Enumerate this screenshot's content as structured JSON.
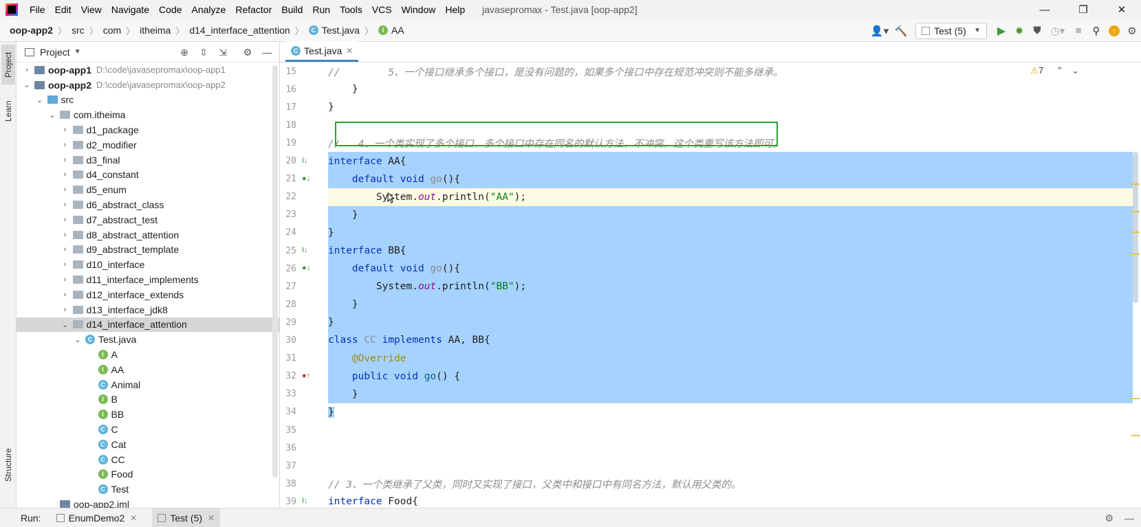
{
  "menubar": {
    "items": [
      "File",
      "Edit",
      "View",
      "Navigate",
      "Code",
      "Analyze",
      "Refactor",
      "Build",
      "Run",
      "Tools",
      "VCS",
      "Window",
      "Help"
    ],
    "title": "javasepromax - Test.java [oop-app2]"
  },
  "breadcrumbs": [
    "oop-app2",
    "src",
    "com",
    "itheima",
    "d14_interface_attention",
    "Test.java",
    "AA"
  ],
  "run_config": "Test (5)",
  "stripe": {
    "project": "Project",
    "learn": "Learn",
    "structure": "Structure"
  },
  "project": {
    "header": "Project",
    "tree": [
      {
        "label": "oop-app1",
        "path": "D:\\code\\javasepromax\\oop-app1",
        "level": 0,
        "kind": "module",
        "expanded": false
      },
      {
        "label": "oop-app2",
        "path": "D:\\code\\javasepromax\\oop-app2",
        "level": 0,
        "kind": "module",
        "expanded": true
      },
      {
        "label": "src",
        "level": 1,
        "kind": "src",
        "expanded": true
      },
      {
        "label": "com.itheima",
        "level": 2,
        "kind": "package",
        "expanded": true
      },
      {
        "label": "d1_package",
        "level": 3,
        "kind": "package",
        "expanded": false
      },
      {
        "label": "d2_modifier",
        "level": 3,
        "kind": "package",
        "expanded": false
      },
      {
        "label": "d3_final",
        "level": 3,
        "kind": "package",
        "expanded": false
      },
      {
        "label": "d4_constant",
        "level": 3,
        "kind": "package",
        "expanded": false
      },
      {
        "label": "d5_enum",
        "level": 3,
        "kind": "package",
        "expanded": false
      },
      {
        "label": "d6_abstract_class",
        "level": 3,
        "kind": "package",
        "expanded": false
      },
      {
        "label": "d7_abstract_test",
        "level": 3,
        "kind": "package",
        "expanded": false
      },
      {
        "label": "d8_abstract_attention",
        "level": 3,
        "kind": "package",
        "expanded": false
      },
      {
        "label": "d9_abstract_template",
        "level": 3,
        "kind": "package",
        "expanded": false
      },
      {
        "label": "d10_interface",
        "level": 3,
        "kind": "package",
        "expanded": false
      },
      {
        "label": "d11_interface_implements",
        "level": 3,
        "kind": "package",
        "expanded": false
      },
      {
        "label": "d12_interface_extends",
        "level": 3,
        "kind": "package",
        "expanded": false
      },
      {
        "label": "d13_interface_jdk8",
        "level": 3,
        "kind": "package",
        "expanded": false
      },
      {
        "label": "d14_interface_attention",
        "level": 3,
        "kind": "package",
        "expanded": true,
        "selected": true
      },
      {
        "label": "Test.java",
        "level": 4,
        "kind": "file",
        "expanded": true
      },
      {
        "label": "A",
        "level": 5,
        "kind": "interface"
      },
      {
        "label": "AA",
        "level": 5,
        "kind": "interface"
      },
      {
        "label": "Animal",
        "level": 5,
        "kind": "class"
      },
      {
        "label": "B",
        "level": 5,
        "kind": "interface"
      },
      {
        "label": "BB",
        "level": 5,
        "kind": "interface"
      },
      {
        "label": "C",
        "level": 5,
        "kind": "class"
      },
      {
        "label": "Cat",
        "level": 5,
        "kind": "class"
      },
      {
        "label": "CC",
        "level": 5,
        "kind": "class"
      },
      {
        "label": "Food",
        "level": 5,
        "kind": "interface"
      },
      {
        "label": "Test",
        "level": 5,
        "kind": "mainclass"
      },
      {
        "label": "oop-app2.iml",
        "level": 2,
        "kind": "iml"
      }
    ]
  },
  "editor": {
    "tab": "Test.java",
    "warnings": "7",
    "lines": [
      {
        "n": "15",
        "tokens": [
          [
            "cm",
            "//        5、一个接口继承多个接口，是没有问题的，如果多个接口中存在规范冲突则不能多继承。"
          ]
        ]
      },
      {
        "n": "16",
        "tokens": [
          [
            "",
            "    }"
          ]
        ]
      },
      {
        "n": "17",
        "tokens": [
          [
            "",
            "}"
          ]
        ]
      },
      {
        "n": "18",
        "tokens": []
      },
      {
        "n": "19",
        "tokens": [
          [
            "cm",
            "//   4、一个类实现了多个接口，多个接口中存在同名的默认方法，不冲突，这个类重写该方法即可。"
          ]
        ]
      },
      {
        "n": "20",
        "tokens": [
          [
            "kw",
            "interface"
          ],
          [
            "",
            " AA{"
          ]
        ],
        "sel": true,
        "gmark": "I↓"
      },
      {
        "n": "21",
        "tokens": [
          [
            "",
            "    "
          ],
          [
            "kw",
            "default void "
          ],
          [
            "grey",
            "go"
          ],
          [
            "",
            "(){"
          ]
        ],
        "sel": true,
        "gmark": "●↓"
      },
      {
        "n": "22",
        "tokens": [
          [
            "",
            "        System."
          ],
          [
            "fld",
            "out"
          ],
          [
            "",
            ".println("
          ],
          [
            "str",
            "\"AA\""
          ],
          [
            "",
            ");"
          ]
        ],
        "sel": true,
        "current": true
      },
      {
        "n": "23",
        "tokens": [
          [
            "",
            "    }"
          ]
        ],
        "sel": true
      },
      {
        "n": "24",
        "tokens": [
          [
            "",
            "}"
          ]
        ],
        "sel": true
      },
      {
        "n": "25",
        "tokens": [
          [
            "kw",
            "interface"
          ],
          [
            "",
            " BB{"
          ]
        ],
        "sel": true,
        "gmark": "I↓"
      },
      {
        "n": "26",
        "tokens": [
          [
            "",
            "    "
          ],
          [
            "kw",
            "default void "
          ],
          [
            "grey",
            "go"
          ],
          [
            "",
            "(){"
          ]
        ],
        "sel": true,
        "gmark": "●↓"
      },
      {
        "n": "27",
        "tokens": [
          [
            "",
            "        System."
          ],
          [
            "fld",
            "out"
          ],
          [
            "",
            ".println("
          ],
          [
            "str",
            "\"BB\""
          ],
          [
            "",
            ");"
          ]
        ],
        "sel": true
      },
      {
        "n": "28",
        "tokens": [
          [
            "",
            "    }"
          ]
        ],
        "sel": true
      },
      {
        "n": "29",
        "tokens": [
          [
            "",
            "}"
          ]
        ],
        "sel": true
      },
      {
        "n": "30",
        "tokens": [
          [
            "kw",
            "class "
          ],
          [
            "grey",
            "CC "
          ],
          [
            "kw",
            "implements"
          ],
          [
            "",
            " AA, BB{"
          ]
        ],
        "sel": true
      },
      {
        "n": "31",
        "tokens": [
          [
            "",
            "    "
          ],
          [
            "ann",
            "@Override"
          ]
        ],
        "sel": true
      },
      {
        "n": "32",
        "tokens": [
          [
            "",
            "    "
          ],
          [
            "kw",
            "public void "
          ],
          [
            "fn",
            "go"
          ],
          [
            "",
            "() {"
          ]
        ],
        "sel": true,
        "gmark": "●↑"
      },
      {
        "n": "33",
        "tokens": [
          [
            "",
            "    }"
          ]
        ],
        "sel": true
      },
      {
        "n": "34",
        "tokens": [
          [
            "",
            "}"
          ]
        ],
        "selpartial": true
      },
      {
        "n": "35",
        "tokens": []
      },
      {
        "n": "36",
        "tokens": []
      },
      {
        "n": "37",
        "tokens": []
      },
      {
        "n": "38",
        "tokens": [
          [
            "cm",
            "// 3、一个类继承了父类，同时又实现了接口，父类中和接口中有同名方法，默认用父类的。"
          ]
        ]
      },
      {
        "n": "39",
        "tokens": [
          [
            "kw",
            "interface"
          ],
          [
            "",
            " Food{"
          ]
        ],
        "gmark": "I↓"
      }
    ]
  },
  "runbar": {
    "label": "Run:",
    "tabs": [
      "EnumDemo2",
      "Test (5)"
    ]
  }
}
